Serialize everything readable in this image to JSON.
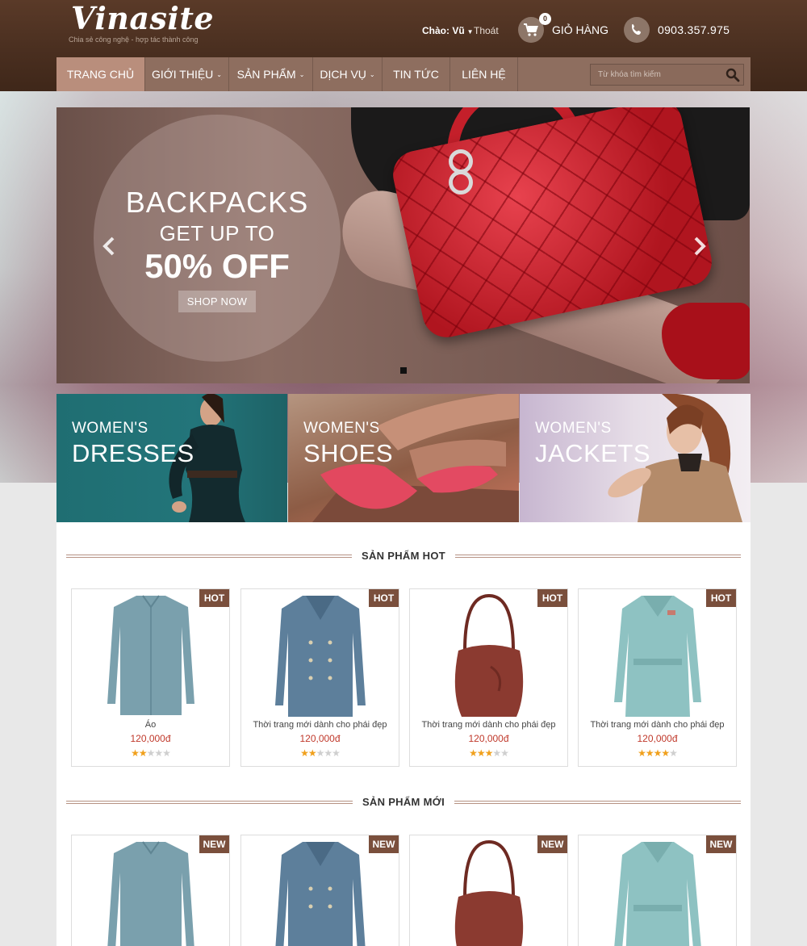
{
  "header": {
    "logo": "Vinasite",
    "tagline": "Chia sẻ công nghệ - hợp tác thành công",
    "greeting": "Chào: Vũ",
    "logout": "Thoát",
    "cart_count": "0",
    "cart_label": "GIỎ HÀNG",
    "phone": "0903.357.975"
  },
  "nav": {
    "items": [
      {
        "label": "TRANG CHỦ",
        "active": true
      },
      {
        "label": "GIỚI THIỆU"
      },
      {
        "label": "SẢN PHẨM"
      },
      {
        "label": "DỊCH VỤ"
      },
      {
        "label": "TIN TỨC"
      },
      {
        "label": "LIÊN HỆ"
      }
    ],
    "search_placeholder": "Từ khóa tìm kiếm"
  },
  "slider": {
    "line1": "BACKPACKS",
    "line2": "GET UP TO",
    "line3": "50% OFF",
    "button": "SHOP NOW"
  },
  "categories": [
    {
      "small": "WOMEN'S",
      "big": "DRESSES"
    },
    {
      "small": "WOMEN'S",
      "big": "SHOES"
    },
    {
      "small": "WOMEN'S",
      "big": "JACKETS"
    }
  ],
  "hot": {
    "title": "SẢN PHẨM HOT",
    "badge": "HOT",
    "products": [
      {
        "name": "Áo",
        "price": "120,000đ",
        "rating": 2
      },
      {
        "name": "Thời trang mới dành cho phái đẹp",
        "price": "120,000đ",
        "rating": 2
      },
      {
        "name": "Thời trang mới dành cho phái đẹp",
        "price": "120,000đ",
        "rating": 3
      },
      {
        "name": "Thời trang mới dành cho phái đẹp",
        "price": "120,000đ",
        "rating": 4
      }
    ]
  },
  "new": {
    "title": "SẢN PHẨM MỚI",
    "badge": "NEW"
  },
  "colors": {
    "header": "#4a2f20",
    "nav": "#8e6e5f",
    "nav_active": "#b98e7c",
    "badge": "#7a4f3c",
    "price": "#c0392b",
    "star": "#f0a01c"
  }
}
